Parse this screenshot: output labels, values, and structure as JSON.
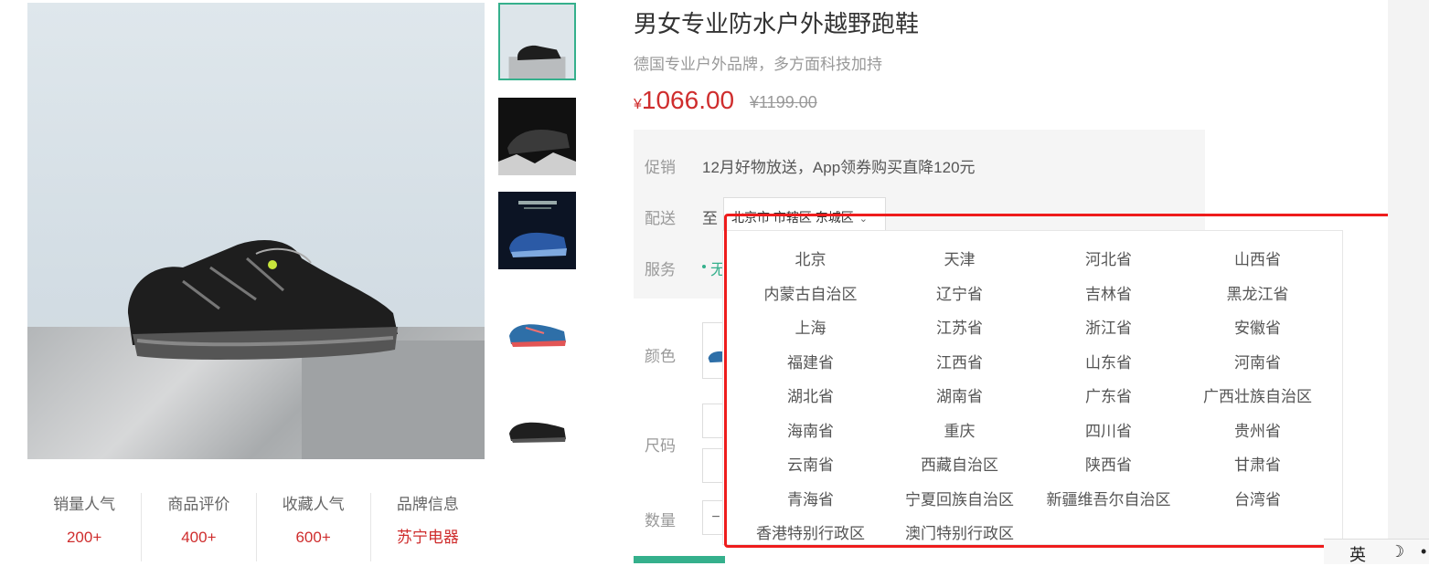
{
  "product": {
    "title": "男女专业防水户外越野跑鞋",
    "subtitle": "德国专业户外品牌，多方面科技加持",
    "price_symbol": "¥",
    "price": "1066.00",
    "original_price": "¥1199.00"
  },
  "stats": [
    {
      "label": "销量人气",
      "value": "200+"
    },
    {
      "label": "商品评价",
      "value": "400+"
    },
    {
      "label": "收藏人气",
      "value": "600+"
    },
    {
      "label": "品牌信息",
      "value": "苏宁电器"
    }
  ],
  "info": {
    "promo_label": "促销",
    "promo_text": "12月好物放送，App领券购买直降120元",
    "delivery_label": "配送",
    "delivery_to": "至",
    "delivery_address": "北京市 市辖区 东城区",
    "service_label": "服务",
    "service_text": "无"
  },
  "options": {
    "color_label": "颜色",
    "size_label": "尺码",
    "quantity_label": "数量",
    "quantity_minus": "−"
  },
  "region_list": [
    "北京",
    "天津",
    "河北省",
    "山西省",
    "内蒙古自治区",
    "辽宁省",
    "吉林省",
    "黑龙江省",
    "上海",
    "江苏省",
    "浙江省",
    "安徽省",
    "福建省",
    "江西省",
    "山东省",
    "河南省",
    "湖北省",
    "湖南省",
    "广东省",
    "广西壮族自治区",
    "海南省",
    "重庆",
    "四川省",
    "贵州省",
    "云南省",
    "西藏自治区",
    "陕西省",
    "甘肃省",
    "青海省",
    "宁夏回族自治区",
    "新疆维吾尔自治区",
    "台湾省",
    "香港特别行政区",
    "澳门特别行政区"
  ],
  "ime": {
    "mode": "英",
    "moon": "☽",
    "dot": "•"
  },
  "colors": {
    "accent_green": "#35b08c",
    "price_red": "#cf2d2d",
    "highlight_red": "#ee1c1c"
  }
}
